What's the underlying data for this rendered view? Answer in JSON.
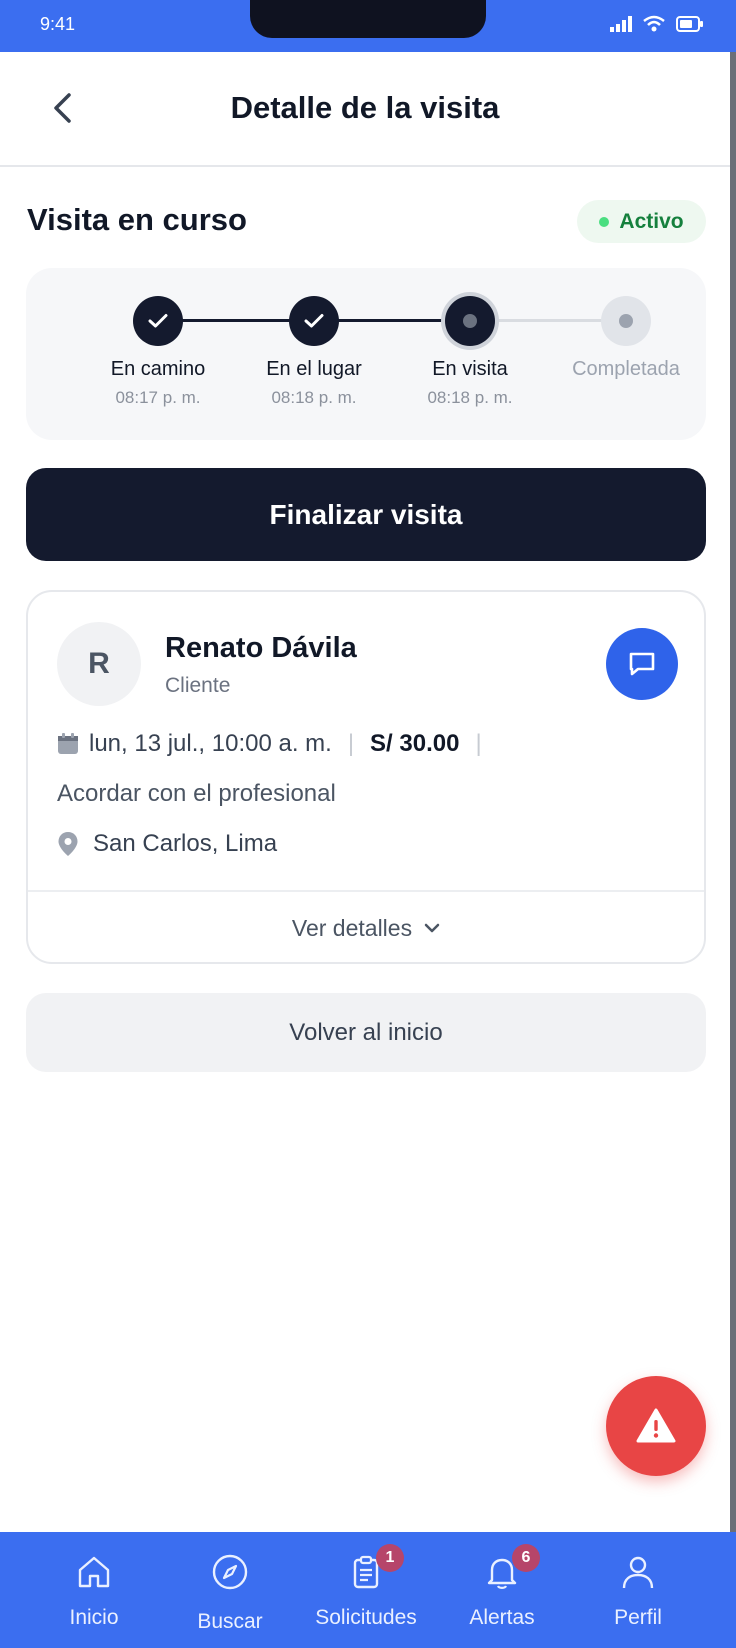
{
  "status_bar": {
    "time": "9:41"
  },
  "header": {
    "title": "Detalle de la visita"
  },
  "visit": {
    "title": "Visita en curso",
    "status": "Activo",
    "colors": {
      "status_bg": "#eef8f0",
      "status_text": "#15803d",
      "status_dot": "#4ade80"
    }
  },
  "steps": [
    {
      "label": "En camino",
      "time": "08:17 p. m.",
      "state": "done"
    },
    {
      "label": "En el lugar",
      "time": "08:18 p. m.",
      "state": "done"
    },
    {
      "label": "En visita",
      "time": "08:18 p. m.",
      "state": "current"
    },
    {
      "label": "Completada",
      "time": "",
      "state": "pending"
    }
  ],
  "actions": {
    "finish": "Finalizar visita",
    "home": "Volver al inicio"
  },
  "client": {
    "initial": "R",
    "name": "Renato Dávila",
    "role": "Cliente",
    "date": "lun, 13 jul., 10:00 a. m.",
    "price": "S/ 30.00",
    "note": "Acordar con el profesional",
    "location": "San Carlos, Lima",
    "details_label": "Ver detalles"
  },
  "nav": {
    "items": [
      {
        "label": "Inicio",
        "icon": "home-icon"
      },
      {
        "label": "Buscar",
        "icon": "compass-icon"
      },
      {
        "label": "Solicitudes",
        "icon": "clipboard-icon",
        "badge": "1"
      },
      {
        "label": "Alertas",
        "icon": "bell-icon",
        "badge": "6"
      },
      {
        "label": "Perfil",
        "icon": "user-icon"
      }
    ]
  },
  "theme": {
    "brand": "#3b6ef0",
    "dark": "#141a2e",
    "danger": "#e84545",
    "chat": "#2f63ea"
  }
}
